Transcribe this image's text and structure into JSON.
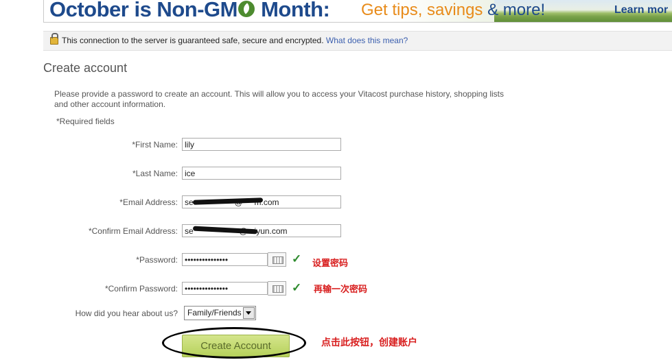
{
  "banner": {
    "headline_a": "October is Non-GM",
    "headline_b": "Month:",
    "tips_a": "Get tips, savings",
    "tips_b": "& more!",
    "learn": "Learn mor",
    "icon": "leaf-icon"
  },
  "secure": {
    "icon": "lock-icon",
    "text": "This connection to the server is guaranteed safe, secure and encrypted.",
    "link": "What does this mean?"
  },
  "page": {
    "title": "Create account",
    "intro": "Please provide a password to create an account. This will allow you to access your Vitacost purchase history, shopping lists and other account information.",
    "required": "*Required fields"
  },
  "form": {
    "first_name_label": "*First Name:",
    "first_name_value": "lily",
    "last_name_label": "*Last Name:",
    "last_name_value": "ice",
    "email_label": "*Email Address:",
    "email_value": "se                  @     m.com",
    "confirm_email_label": "*Confirm Email Address:",
    "confirm_email_value": "se                    @   iyun.com",
    "password_label": "*Password:",
    "password_value": "•••••••••••••••",
    "confirm_password_label": "*Confirm Password:",
    "confirm_password_value": "•••••••••••••••",
    "hear_label": "How did you hear about us?",
    "hear_value": "Family/Friends",
    "submit": "Create Account"
  },
  "annotations": {
    "check": "✓",
    "set_password": "设置密码",
    "reenter_password": "再输一次密码",
    "click_button": "点击此按钮，创建账户"
  },
  "colors": {
    "accent": "#1e4a8c",
    "link": "#3b5fae",
    "button": "#b6d15b",
    "annotation": "#d81e1e",
    "check": "#2e8b2e"
  }
}
